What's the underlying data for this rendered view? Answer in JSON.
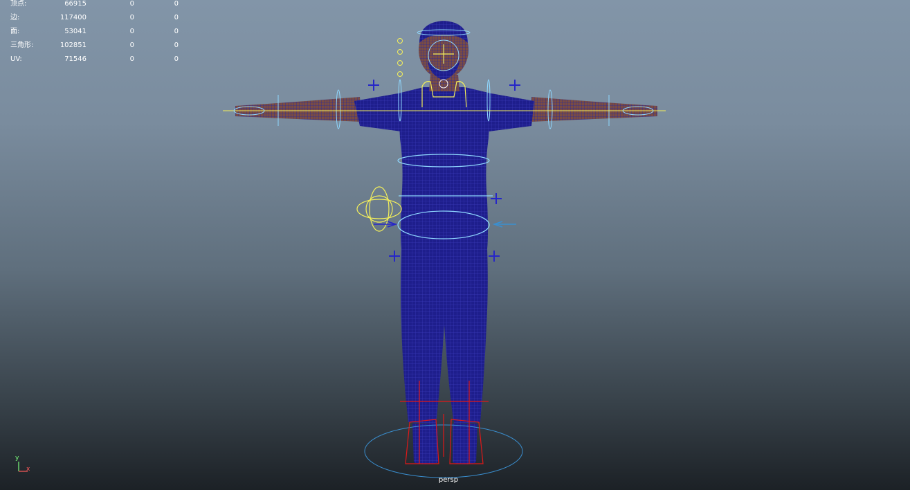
{
  "hud": {
    "rows": [
      {
        "label": "顶点:",
        "v1": "66915",
        "v2": "0",
        "v3": "0"
      },
      {
        "label": "边:",
        "v1": "117400",
        "v2": "0",
        "v3": "0"
      },
      {
        "label": "面:",
        "v1": "53041",
        "v2": "0",
        "v3": "0"
      },
      {
        "label": "三角形:",
        "v1": "102851",
        "v2": "0",
        "v3": "0"
      },
      {
        "label": "UV:",
        "v1": "71546",
        "v2": "0",
        "v3": "0"
      }
    ]
  },
  "viewport": {
    "camera_label": "persp",
    "axis_y": "y",
    "axis_x": "x"
  },
  "colors": {
    "mesh": "#1e1e8c",
    "wire": "#3a3ab8",
    "skin": "#8a5a4a",
    "control_cyan": "#8fd8ff",
    "control_yellow": "#f5f05a",
    "control_blue": "#2626c8",
    "foot_red": "#e01818"
  }
}
